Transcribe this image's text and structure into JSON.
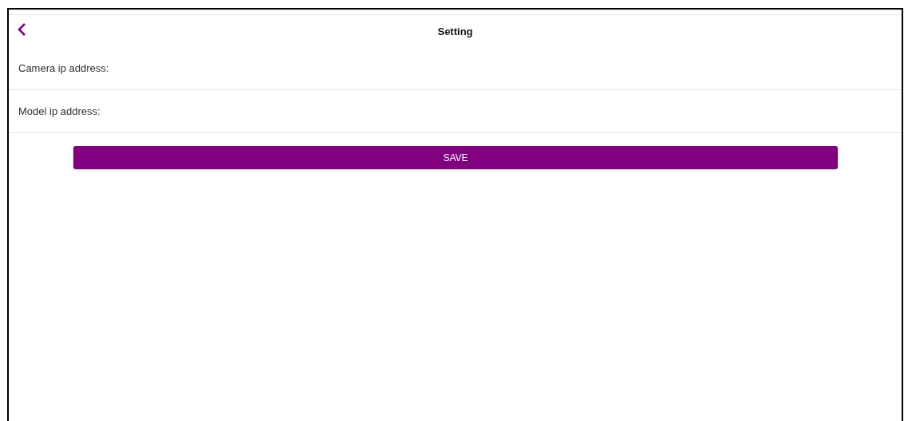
{
  "header": {
    "title": "Setting"
  },
  "fields": [
    {
      "label": "Camera ip address:"
    },
    {
      "label": "Model ip address:"
    }
  ],
  "save_button": {
    "label": "SAVE"
  }
}
